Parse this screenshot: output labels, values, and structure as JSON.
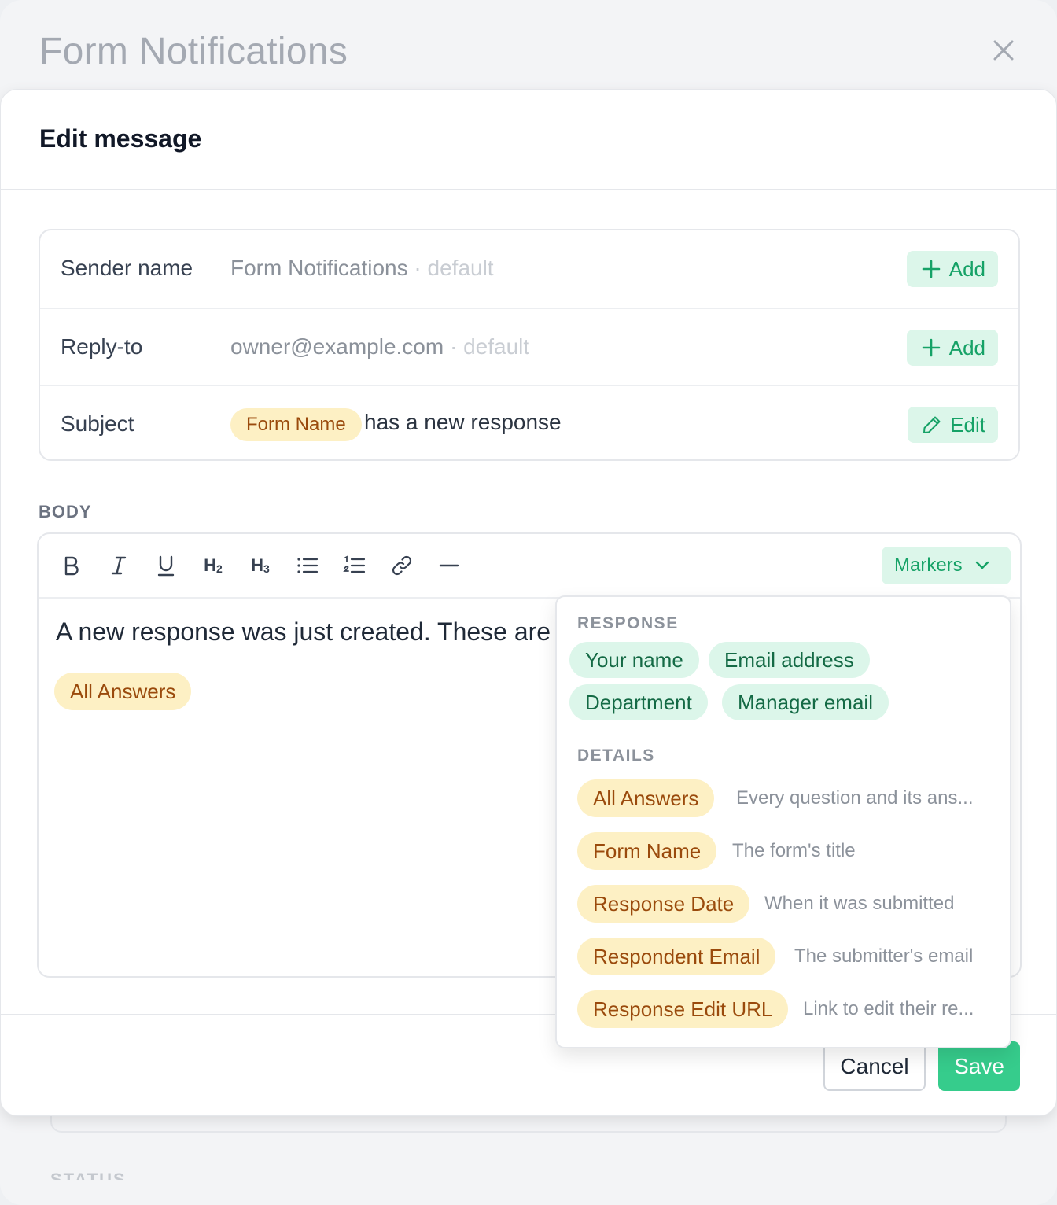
{
  "background": {
    "title": "Form Notifications",
    "close_icon": "close-icon",
    "status_label": "STATUS"
  },
  "modal": {
    "title": "Edit message",
    "fields": {
      "sender": {
        "label": "Sender name",
        "value": "Form Notifications",
        "default": "default",
        "button": "Add"
      },
      "reply_to": {
        "label": "Reply-to",
        "value": "owner@example.com",
        "default": "default",
        "button": "Add"
      },
      "subject": {
        "label": "Subject",
        "tag": "Form Name",
        "text": "has a new response",
        "button": "Edit"
      }
    },
    "body": {
      "label": "BODY",
      "toolbar": {
        "bold": "B",
        "h2": "H2",
        "h3": "H3",
        "markers": "Markers"
      },
      "text": "A new response was just created. These are",
      "tag": "All Answers"
    },
    "footer": {
      "cancel": "Cancel",
      "save": "Save"
    }
  },
  "markers_dropdown": {
    "response_section": "RESPONSE",
    "response_chips": [
      "Your name",
      "Email address",
      "Department",
      "Manager email"
    ],
    "details_section": "DETAILS",
    "details": [
      {
        "chip": "All Answers",
        "desc": "Every question and its ans..."
      },
      {
        "chip": "Form Name",
        "desc": "The form's title"
      },
      {
        "chip": "Response Date",
        "desc": "When it was submitted"
      },
      {
        "chip": "Respondent Email",
        "desc": "The submitter's email"
      },
      {
        "chip": "Response Edit URL",
        "desc": "Link to edit their re..."
      }
    ]
  },
  "colors": {
    "accent_green": "#16a267",
    "green_bg": "#dcf6ea",
    "save_green": "#36cc8c",
    "tag_yellow_bg": "#fdf0c4",
    "tag_yellow_text": "#9a4a0c"
  }
}
